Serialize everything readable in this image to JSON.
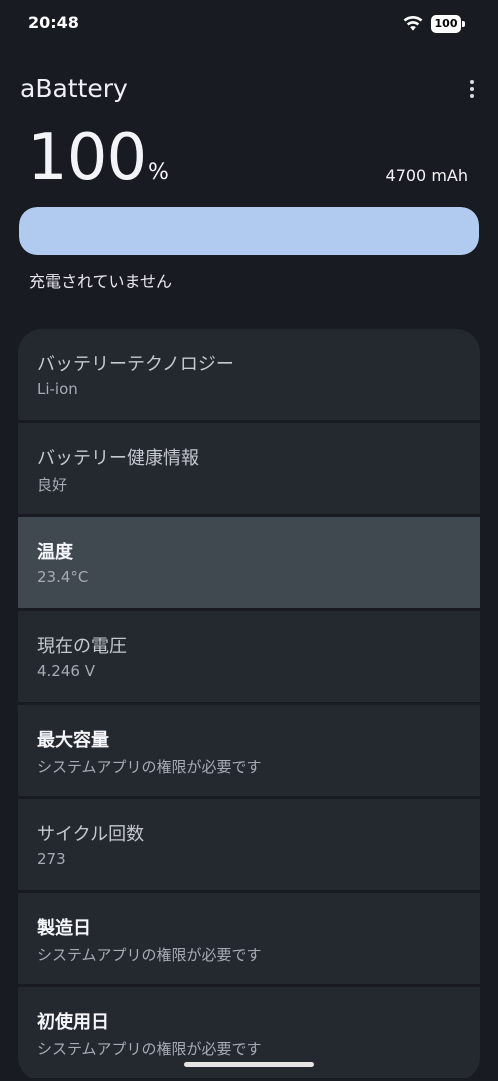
{
  "status_bar": {
    "time": "20:48",
    "battery_text": "100",
    "icons": [
      "wifi-icon",
      "battery-icon"
    ]
  },
  "app": {
    "title": "aBattery",
    "menu_icon": "more-vert-icon"
  },
  "battery": {
    "level": "100",
    "level_unit": "%",
    "level_fraction": 1.0,
    "capacity": "4700 mAh",
    "charge_status": "充電されていません"
  },
  "info_items": [
    {
      "label": "バッテリーテクノロジー",
      "value": "Li-ion"
    },
    {
      "label": "バッテリー健康情報",
      "value": "良好"
    },
    {
      "label": "温度",
      "value": "23.4°C"
    },
    {
      "label": "現在の電圧",
      "value": "4.246 V"
    },
    {
      "label": "最大容量",
      "value": "システムアプリの権限が必要です"
    },
    {
      "label": "サイクル回数",
      "value": "273"
    },
    {
      "label": "製造日",
      "value": "システムアプリの権限が必要です"
    },
    {
      "label": "初使用日",
      "value": "システムアプリの権限が必要です"
    }
  ],
  "colors": {
    "background": "#181b21",
    "bar_fill": "#b0cbef",
    "card": "#24282f",
    "card_selected": "#404850"
  }
}
